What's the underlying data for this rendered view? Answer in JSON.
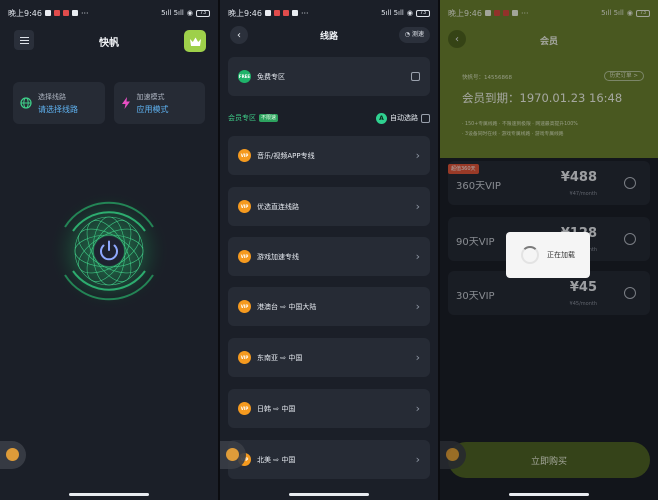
{
  "status_bar": {
    "time": "晚上9:46",
    "indicators": "···",
    "signal": "5ıll 5ıll",
    "battery": "73"
  },
  "home": {
    "title": "快帆",
    "cards": [
      {
        "title": "选择线路",
        "value": "请选择线路",
        "icon": "globe-icon"
      },
      {
        "title": "加速模式",
        "value": "应用模式",
        "icon": "lightning-icon"
      }
    ],
    "power_icon": "power-icon",
    "vip_icon": "crown-icon"
  },
  "routes": {
    "title": "线路",
    "speed_test": "测速",
    "free_zone": "免费专区",
    "free_badge": "FREE",
    "vip_zone": "会员专区",
    "vip_tag": "不限速",
    "auto_select": "自动选路",
    "auto_badge": "A",
    "vip_badge": "VIP",
    "items": [
      {
        "label": "音乐/视频APP专线"
      },
      {
        "label": "优选直连线路"
      },
      {
        "label": "游戏加速专线"
      },
      {
        "label": "港澳台 ⇨ 中国大陆"
      },
      {
        "label": "东南亚 ⇨ 中国"
      },
      {
        "label": "日韩 ⇨ 中国"
      },
      {
        "label": "北美 ⇨ 中国"
      }
    ]
  },
  "membership": {
    "title": "会员",
    "account_label": "快帆号：",
    "account_id": "14556868",
    "history": "历史订单 >",
    "expiry": "会员到期：1970.01.23 16:48",
    "perks": [
      "· 150+专属线路 · 不限速到极限 · 网速最高提升100%",
      "· 3设备同时在线 · 游戏专属线路 · 游戏专属线路"
    ],
    "hot_tag": "超值360天",
    "plans": [
      {
        "name": "360天VIP",
        "price": "¥488",
        "per": "¥47/month"
      },
      {
        "name": "90天VIP",
        "price": "¥128",
        "per": "¥42/month"
      },
      {
        "name": "30天VIP",
        "price": "¥45",
        "per": "¥45/month"
      }
    ],
    "buy": "立即购买",
    "loading": "正在加载"
  },
  "colors": {
    "accent_green": "#3fd08a",
    "member_gold": "#6c8230",
    "vip_orange": "#f59a1f"
  }
}
